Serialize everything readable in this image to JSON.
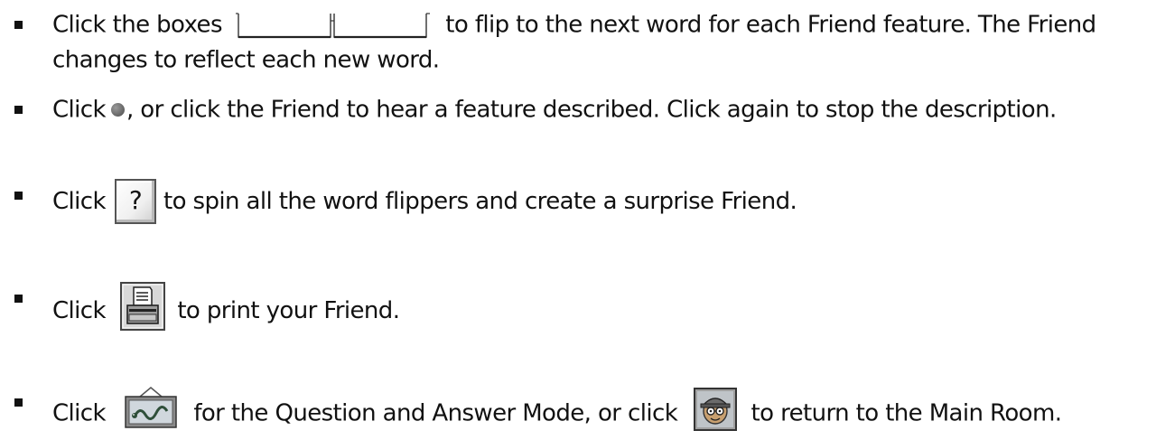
{
  "instructions": [
    {
      "before": "Click the boxes",
      "after": "to flip to the next word for each Friend feature. The Friend",
      "continuation": "changes to reflect each new word.",
      "icon": "word-flipper-boxes"
    },
    {
      "before": "Click",
      "after": ", or click the Friend to hear a feature described. Click again to stop the description.",
      "icon": "gray-circle"
    },
    {
      "before": "Click",
      "after": "to spin all the word flippers and create a surprise Friend.",
      "icon": "question-button",
      "icon_label": "?"
    },
    {
      "before": "Click",
      "after": "to print your Friend.",
      "icon": "printer-button"
    },
    {
      "before": "Click",
      "middle": "for the Question and Answer Mode, or click",
      "after": "to return to the Main Room.",
      "icons": [
        "question-answer-picture-frame",
        "main-room-friend-portrait"
      ]
    }
  ]
}
